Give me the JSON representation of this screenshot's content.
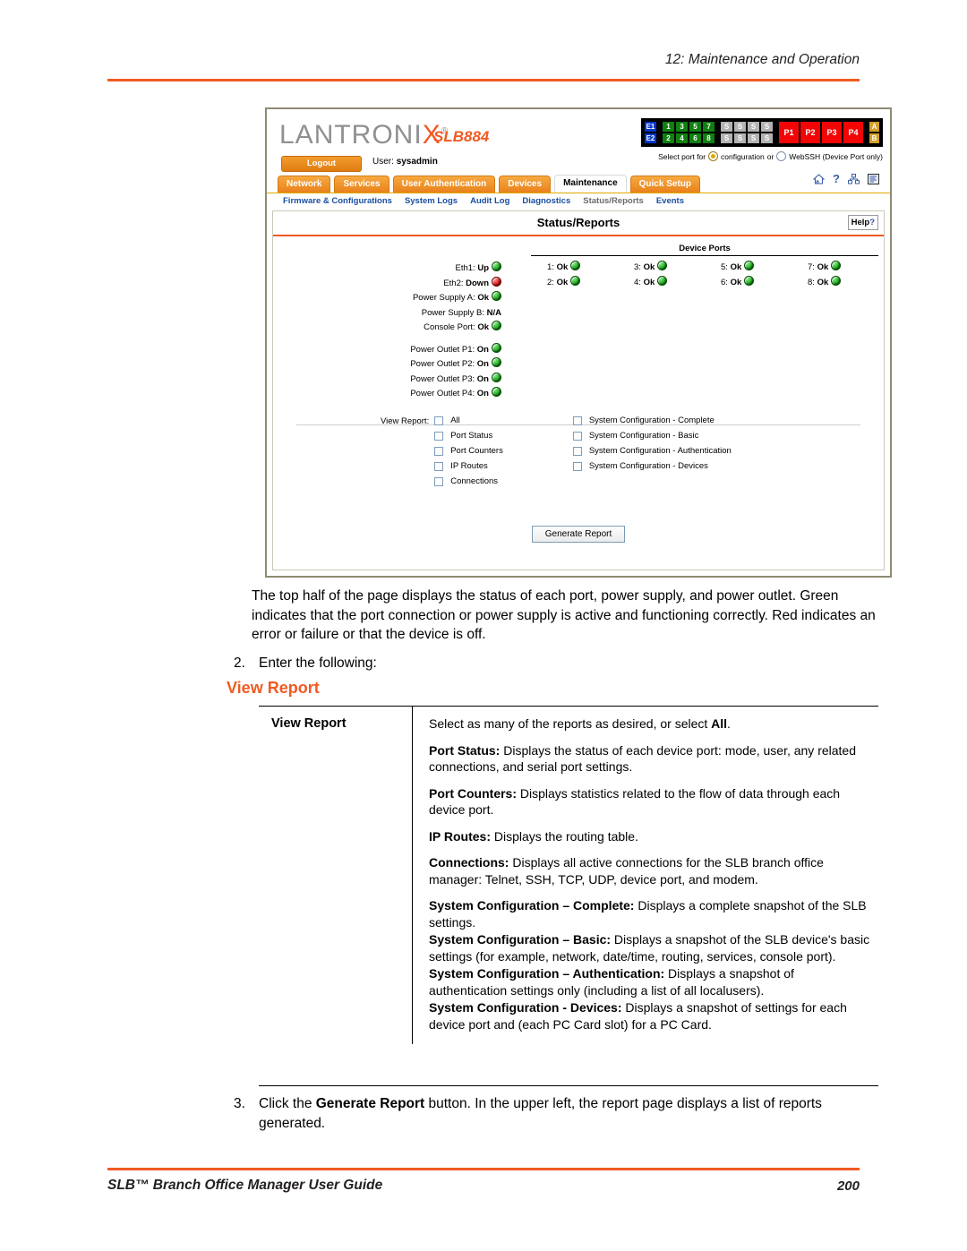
{
  "page": {
    "running_head": "12: Maintenance and Operation",
    "footer_left": "SLB™ Branch Office Manager User Guide",
    "footer_page": "200"
  },
  "screenshot": {
    "brand": {
      "logo_text": "LANTRONI",
      "logo_x": "X",
      "logo_reg": "®",
      "model": "SLB884"
    },
    "logout_label": "Logout",
    "user_prefix": "User:",
    "user_name": "sysadmin",
    "portmap": {
      "eth": [
        "E1",
        "E2"
      ],
      "numeric_top": [
        "1",
        "3",
        "5",
        "7"
      ],
      "numeric_bottom": [
        "2",
        "4",
        "6",
        "8"
      ],
      "serial_top": [
        "S",
        "S",
        "S",
        "S"
      ],
      "serial_bottom": [
        "S",
        "S",
        "S",
        "S"
      ],
      "power": [
        "P1",
        "P2",
        "P3",
        "P4"
      ],
      "ab": [
        "A",
        "B"
      ],
      "colors": {
        "eth": "#0033cc",
        "numeric": "#108010",
        "serial": "#b3b3b3",
        "power": "#f20505",
        "ab": "#d4a02a"
      }
    },
    "select_port": {
      "prefix": "Select port for",
      "option_configuration": "configuration",
      "or": "or",
      "option_webssh": "WebSSH (Device Port only)",
      "selected": "configuration"
    },
    "tabs": [
      {
        "label": "Network",
        "active": false
      },
      {
        "label": "Services",
        "active": false
      },
      {
        "label": "User Authentication",
        "active": false
      },
      {
        "label": "Devices",
        "active": false
      },
      {
        "label": "Maintenance",
        "active": true
      },
      {
        "label": "Quick Setup",
        "active": false
      }
    ],
    "header_icons": [
      "home-icon",
      "help-icon",
      "sitemap-icon",
      "list-icon"
    ],
    "subnav": [
      {
        "label": "Firmware & Configurations",
        "current": false
      },
      {
        "label": "System Logs",
        "current": false
      },
      {
        "label": "Audit Log",
        "current": false
      },
      {
        "label": "Diagnostics",
        "current": false
      },
      {
        "label": "Status/Reports",
        "current": true
      },
      {
        "label": "Events",
        "current": false
      }
    ],
    "panel_title": "Status/Reports",
    "help_label": "Help",
    "help_mark": "?",
    "left_status": [
      {
        "label": "Eth1:",
        "value": "Up",
        "led": "green"
      },
      {
        "label": "Eth2:",
        "value": "Down",
        "led": "red"
      },
      {
        "label": "Power Supply A:",
        "value": "Ok",
        "led": "green"
      },
      {
        "label": "Power Supply B:",
        "value": "N/A",
        "led": "none"
      },
      {
        "label": "Console Port:",
        "value": "Ok",
        "led": "green"
      },
      {
        "label": "Power Outlet P1:",
        "value": "On",
        "led": "green"
      },
      {
        "label": "Power Outlet P2:",
        "value": "On",
        "led": "green"
      },
      {
        "label": "Power Outlet P3:",
        "value": "On",
        "led": "green"
      },
      {
        "label": "Power Outlet P4:",
        "value": "On",
        "led": "green"
      }
    ],
    "device_ports_title": "Device Ports",
    "device_ports": [
      {
        "label": "1:",
        "value": "Ok",
        "led": "green"
      },
      {
        "label": "3:",
        "value": "Ok",
        "led": "green"
      },
      {
        "label": "5:",
        "value": "Ok",
        "led": "green"
      },
      {
        "label": "7:",
        "value": "Ok",
        "led": "green"
      },
      {
        "label": "2:",
        "value": "Ok",
        "led": "green"
      },
      {
        "label": "4:",
        "value": "Ok",
        "led": "green"
      },
      {
        "label": "6:",
        "value": "Ok",
        "led": "green"
      },
      {
        "label": "8:",
        "value": "Ok",
        "led": "green"
      }
    ],
    "view_report_label": "View Report:",
    "report_options_left": [
      {
        "label": "All",
        "checked": false
      },
      {
        "label": "Port Status",
        "checked": false
      },
      {
        "label": "Port Counters",
        "checked": false
      },
      {
        "label": "IP Routes",
        "checked": false
      },
      {
        "label": "Connections",
        "checked": false
      }
    ],
    "report_options_right": [
      {
        "label": "System Configuration - Complete",
        "checked": false
      },
      {
        "label": "System Configuration - Basic",
        "checked": false
      },
      {
        "label": "System Configuration - Authentication",
        "checked": false
      },
      {
        "label": "System Configuration - Devices",
        "checked": false
      }
    ],
    "generate_button": "Generate Report"
  },
  "body": {
    "intro_paragraph": "The top half of the page displays the status of each port, power supply, and power outlet. Green indicates that the port connection or power supply is active and functioning correctly. Red indicates an error or failure or that the device is off.",
    "step2_num": "2.",
    "step2_text": "Enter the following:",
    "heading_view_report": "View Report",
    "step3_num": "3.",
    "step3_prefix": "Click the ",
    "step3_bold": "Generate Report",
    "step3_suffix": " button. In the upper left, the report page displays a list of reports generated."
  },
  "table": {
    "row_label": "View Report",
    "p1_text": "Select as many of the reports as desired, or select ",
    "p1_bold": "All",
    "p1_end": ".",
    "p2_bold": "Port Status:",
    "p2_text": " Displays the status of each device port: mode, user, any related connections, and serial port settings.",
    "p3_bold": "Port Counters:",
    "p3_text": " Displays statistics related to the flow of data through each device port.",
    "p4_bold": "IP Routes:",
    "p4_text": " Displays the routing table.",
    "p5_bold": "Connections:",
    "p5_text": " Displays all active connections for the SLB branch office manager: Telnet, SSH, TCP, UDP, device port, and modem.",
    "p6_bold": "System Configuration – Complete:",
    "p6_text": " Displays a complete snapshot of the SLB settings.",
    "p7_bold": "System Configuration – Basic:",
    "p7_text": "  Displays a snapshot of the SLB device's basic settings (for example, network, date/time, routing, services, console port).",
    "p8_bold": "System Configuration – Authentication:",
    "p8_text": " Displays a snapshot of authentication settings only (including a list of all localusers).",
    "p9_bold": "System Configuration - Devices:",
    "p9_text": "  Displays a snapshot of settings for each device port and (each PC Card slot) for a PC Card."
  }
}
